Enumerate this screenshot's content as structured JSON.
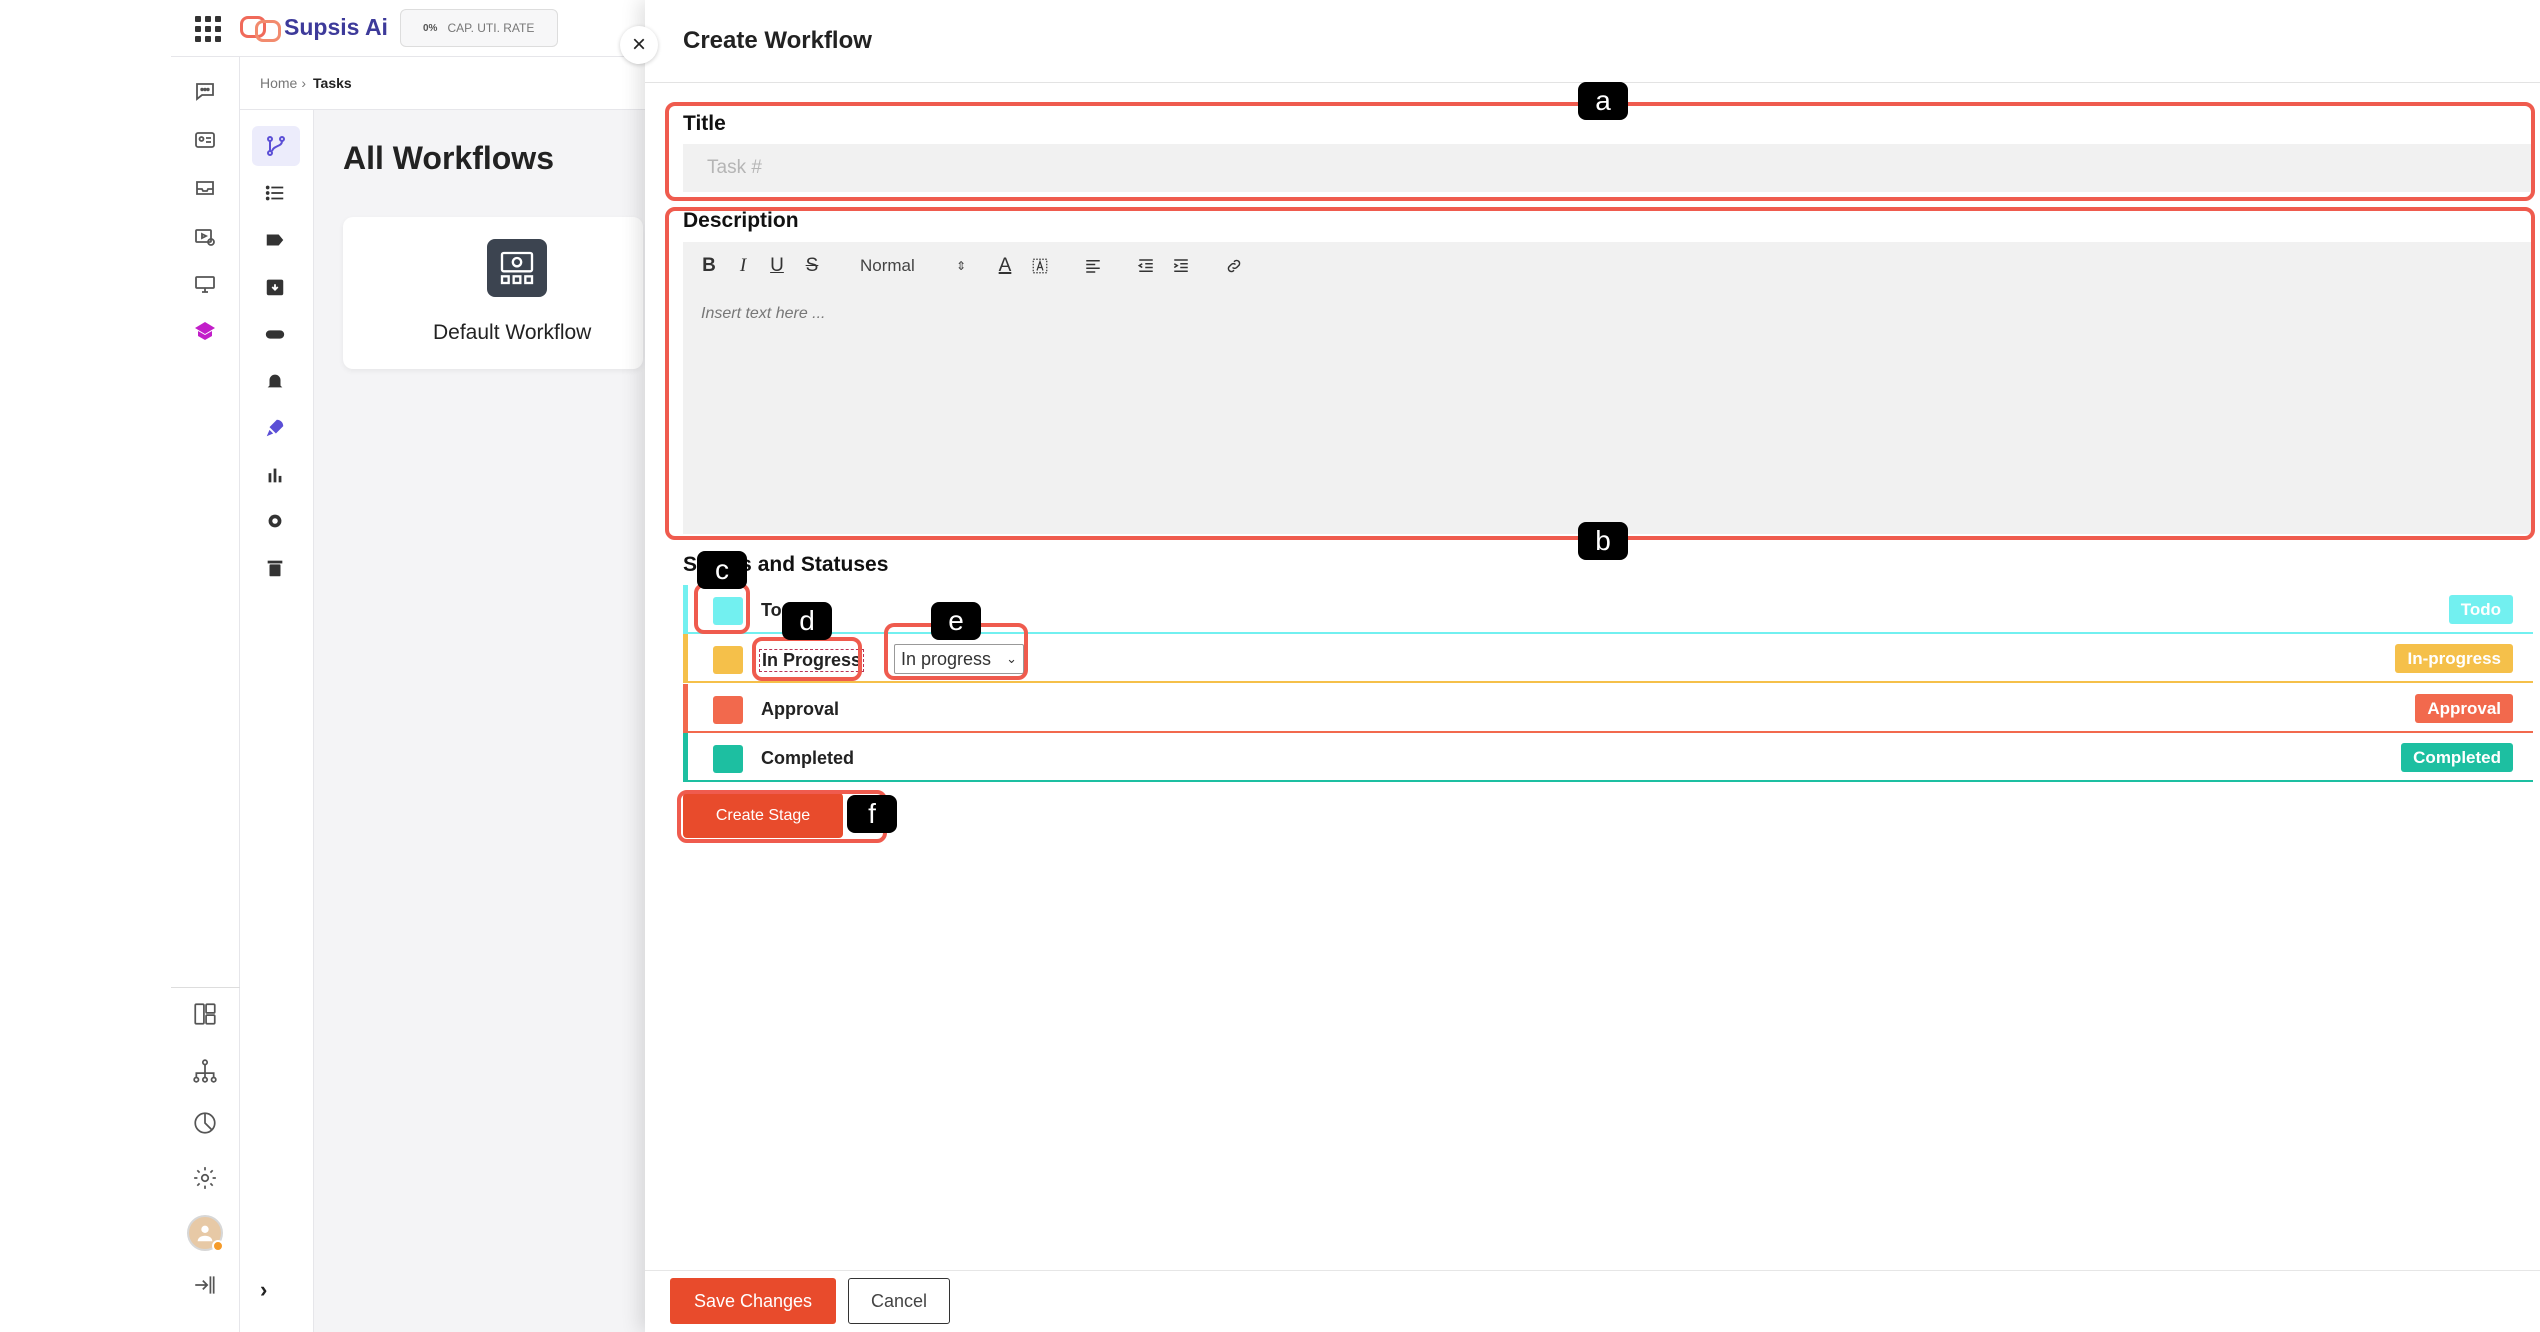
{
  "app": {
    "brand_name": "Supsis Ai",
    "cap_badge": {
      "percent": "0%",
      "label": "CAP. UTI. RATE"
    }
  },
  "breadcrumb": {
    "home": "Home",
    "separator": "›",
    "current": "Tasks"
  },
  "page": {
    "title": "All Workflows",
    "workflows": [
      {
        "label": "Default Workflow"
      }
    ]
  },
  "drawer": {
    "title": "Create Workflow",
    "title_field": {
      "label": "Title",
      "placeholder": "Task #",
      "value": ""
    },
    "description_field": {
      "label": "Description",
      "placeholder": "Insert text here ...",
      "toolbar": {
        "bold": "B",
        "italic": "I",
        "underline": "U",
        "strike": "S",
        "size_select": "Normal",
        "font_color": "A"
      }
    },
    "stages_label": "Stages and Statuses",
    "stages": [
      {
        "name": "Todo",
        "badge": "Todo",
        "color": "#72f0f0"
      },
      {
        "name": "In Progress",
        "badge": "In-progress",
        "color": "#f5c04a",
        "status_select": "In progress"
      },
      {
        "name": "Approval",
        "badge": "Approval",
        "color": "#f2694d"
      },
      {
        "name": "Completed",
        "badge": "Completed",
        "color": "#1dbfa1"
      }
    ],
    "create_stage_label": "Create Stage",
    "save_label": "Save Changes",
    "cancel_label": "Cancel"
  },
  "annotations": [
    "a",
    "b",
    "c",
    "d",
    "e",
    "f"
  ],
  "colors": {
    "accent": "#e84b2c",
    "annotation": "#ef5b4e",
    "brand": "#3d3a9a"
  }
}
